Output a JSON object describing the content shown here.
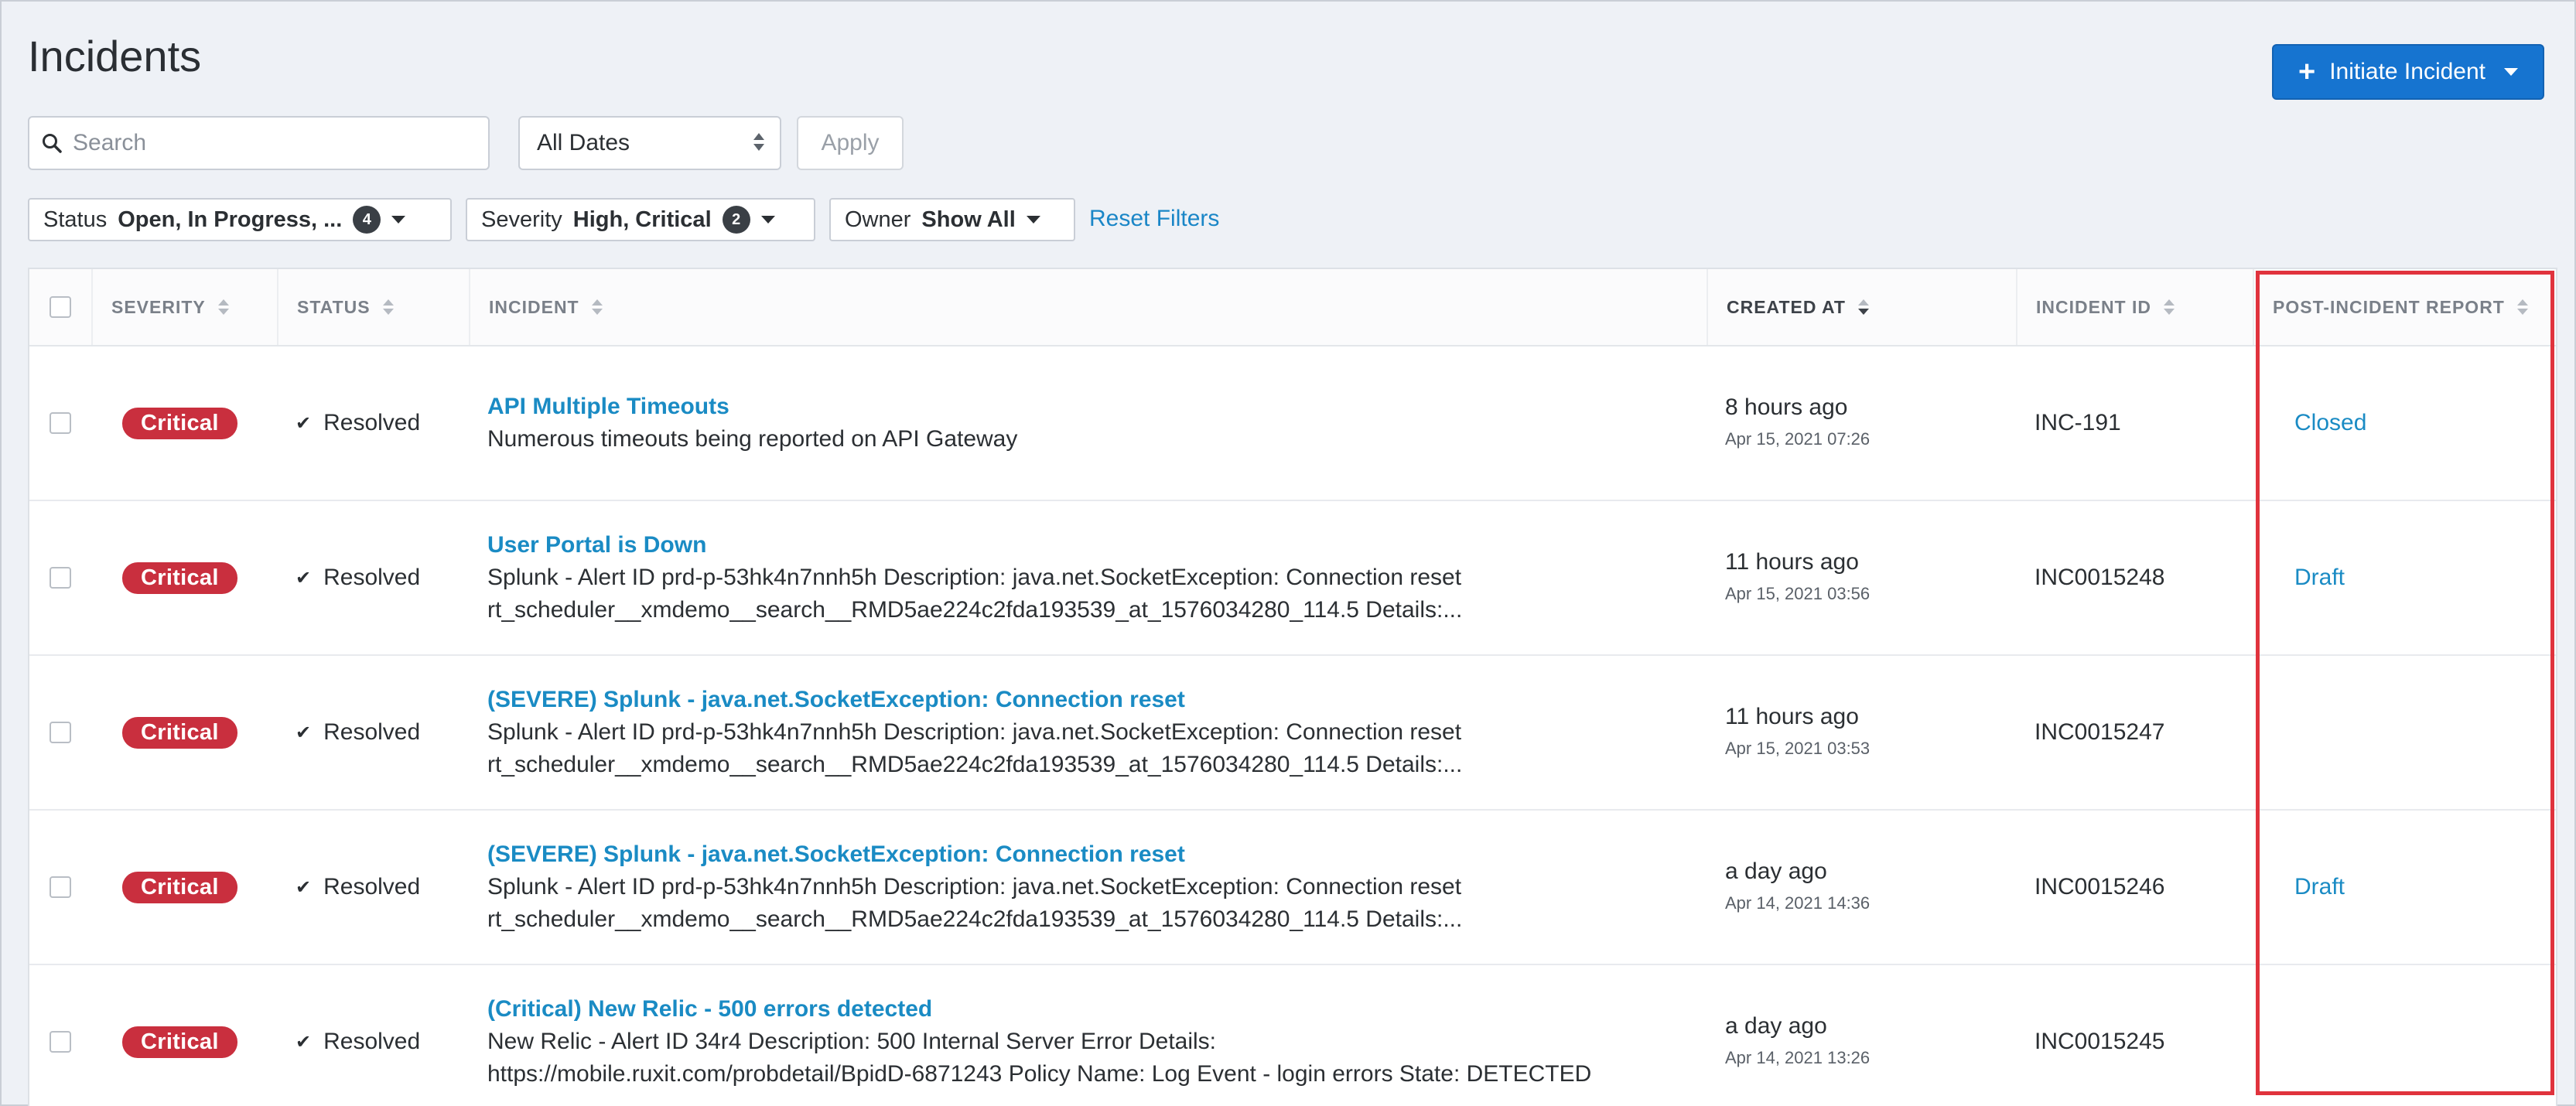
{
  "page": {
    "title": "Incidents"
  },
  "header": {
    "initiate_label": "Initiate Incident"
  },
  "filters": {
    "search_placeholder": "Search",
    "dates_value": "All Dates",
    "apply_label": "Apply",
    "status_label": "Status",
    "status_value": "Open, In Progress, ...",
    "status_count": "4",
    "severity_label": "Severity",
    "severity_value": "High, Critical",
    "severity_count": "2",
    "owner_label": "Owner",
    "owner_value": "Show All",
    "reset_label": "Reset Filters"
  },
  "table": {
    "columns": {
      "severity": "SEVERITY",
      "status": "STATUS",
      "incident": "INCIDENT",
      "created_at": "CREATED AT",
      "incident_id": "INCIDENT ID",
      "post_incident_report": "POST-INCIDENT REPORT"
    },
    "rows": [
      {
        "severity": "Critical",
        "status": "Resolved",
        "title": "API Multiple Timeouts",
        "description": "Numerous timeouts being reported on API Gateway",
        "created_relative": "8 hours ago",
        "created_absolute": "Apr 15, 2021 07:26",
        "incident_id": "INC-191",
        "report": "Closed"
      },
      {
        "severity": "Critical",
        "status": "Resolved",
        "title": "User Portal is Down",
        "description": "Splunk - Alert ID prd-p-53hk4n7nnh5h Description: java.net.SocketException: Connection reset\nrt_scheduler__xmdemo__search__RMD5ae224c2fda193539_at_1576034280_114.5 Details:...",
        "created_relative": "11 hours ago",
        "created_absolute": "Apr 15, 2021 03:56",
        "incident_id": "INC0015248",
        "report": "Draft"
      },
      {
        "severity": "Critical",
        "status": "Resolved",
        "title": "(SEVERE) Splunk - java.net.SocketException: Connection reset",
        "description": "Splunk - Alert ID prd-p-53hk4n7nnh5h Description: java.net.SocketException: Connection reset\nrt_scheduler__xmdemo__search__RMD5ae224c2fda193539_at_1576034280_114.5 Details:...",
        "created_relative": "11 hours ago",
        "created_absolute": "Apr 15, 2021 03:53",
        "incident_id": "INC0015247",
        "report": ""
      },
      {
        "severity": "Critical",
        "status": "Resolved",
        "title": "(SEVERE) Splunk - java.net.SocketException: Connection reset",
        "description": "Splunk - Alert ID prd-p-53hk4n7nnh5h Description: java.net.SocketException: Connection reset\nrt_scheduler__xmdemo__search__RMD5ae224c2fda193539_at_1576034280_114.5 Details:...",
        "created_relative": "a day ago",
        "created_absolute": "Apr 14, 2021 14:36",
        "incident_id": "INC0015246",
        "report": "Draft"
      },
      {
        "severity": "Critical",
        "status": "Resolved",
        "title": "(Critical) New Relic - 500 errors detected",
        "description": "New Relic - Alert ID 34r4 Description: 500 Internal Server Error Details:\nhttps://mobile.ruxit.com/probdetail/BpidD-6871243 Policy Name: Log Event - login errors State: DETECTED",
        "created_relative": "a day ago",
        "created_absolute": "Apr 14, 2021 13:26",
        "incident_id": "INC0015245",
        "report": ""
      }
    ]
  },
  "colors": {
    "accent": "#1674d0",
    "link": "#1a8bc4",
    "critical": "#c92f3e",
    "highlight": "#e0333d"
  }
}
